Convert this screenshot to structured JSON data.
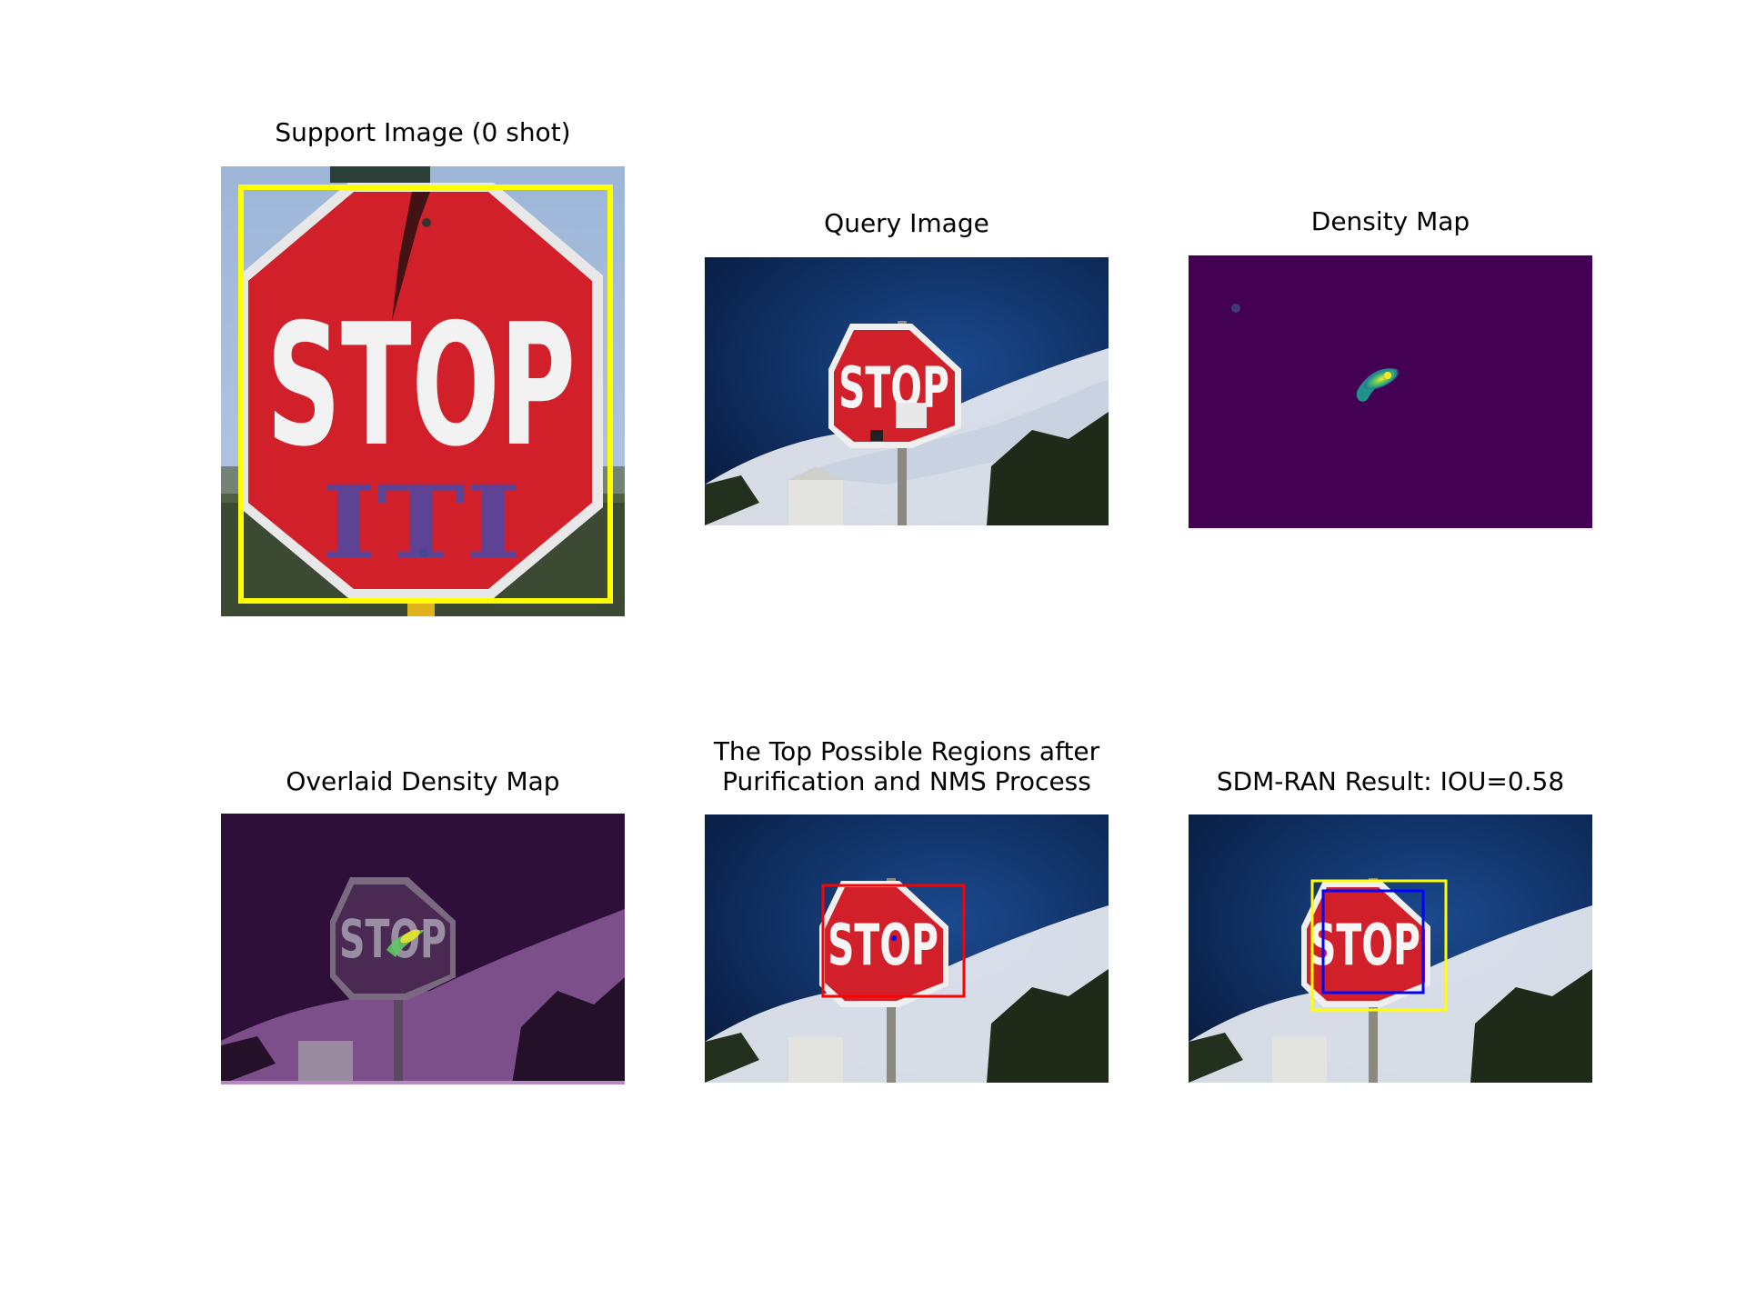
{
  "figure": {
    "panels": [
      {
        "id": "support",
        "title": "Support Image (0 shot)",
        "sign_text": "STOP",
        "graffiti_text": "ITI"
      },
      {
        "id": "query",
        "title": "Query Image",
        "sign_text": "STOP"
      },
      {
        "id": "density",
        "title": "Density Map"
      },
      {
        "id": "overlay",
        "title": "Overlaid Density Map",
        "sign_text": "STOP"
      },
      {
        "id": "regions",
        "title": "The Top Possible Regions after\nPurification and NMS Process",
        "sign_text": "STOP"
      },
      {
        "id": "result",
        "title": "SDM-RAN Result: IOU=0.58",
        "sign_text": "STOP"
      }
    ]
  },
  "colors": {
    "support_box": "#ffff00",
    "region_box": "#ff0000",
    "prediction_box": "#0000ff",
    "ground_truth_box": "#ffff00",
    "density_background": "#440154",
    "sky": "#0c2a5e",
    "stop_red": "#d2202a"
  }
}
